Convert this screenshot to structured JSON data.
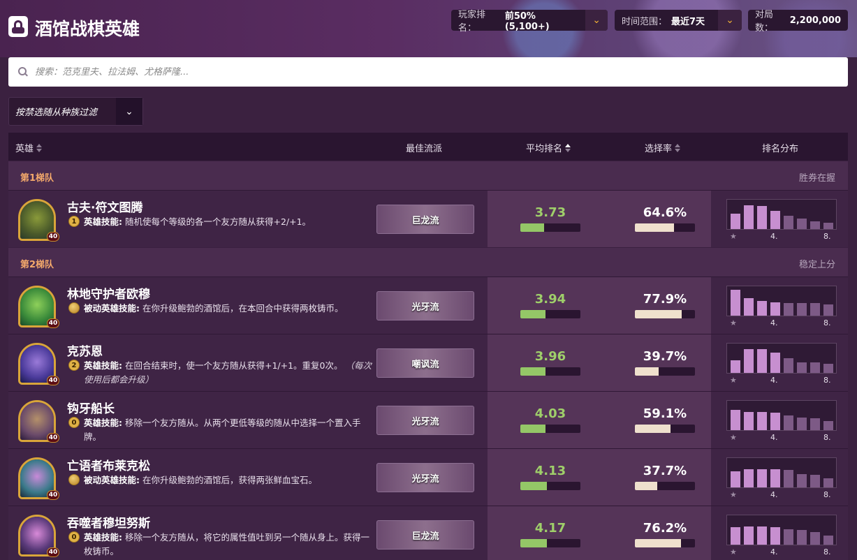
{
  "header": {
    "title": "酒馆战棋英雄",
    "filters": [
      {
        "label": "玩家排名：",
        "value": "前50% (5,100+)"
      },
      {
        "label": "时间范围：",
        "value": "最近7天"
      }
    ],
    "games_label": "对局数：",
    "games_value": "2,200,000"
  },
  "search": {
    "placeholder": "搜索：范克里夫、拉法姆、尤格萨隆..."
  },
  "filter_dropdown": {
    "label": "按禁选随从种族过滤"
  },
  "columns": {
    "hero": "英雄",
    "comp": "最佳流派",
    "avg": "平均排名",
    "pick": "选择率",
    "dist": "排名分布"
  },
  "colors": {
    "accent": "#f2b134",
    "avg_green": "#9fcf6a",
    "tier_orange": "#f4a96b",
    "bar_dark": "#c78fd0",
    "bar_light": "#7d5a86"
  },
  "dist_labels": {
    "mid": "4.",
    "end": "8."
  },
  "tiers": [
    {
      "name": "第1梯队",
      "desc": "胜券在握",
      "heroes": [
        {
          "name": "古夫·符文图腾",
          "level": "40",
          "power_cost": "1",
          "power_passive": false,
          "power_type": "英雄技能:",
          "power_text": " 随机使每个等级的各一个友方随从获得+2/+1。",
          "power_note": "",
          "comp": "巨龙流",
          "avg": "3.73",
          "avg_fraction": 0.39,
          "pick": "64.6%",
          "pick_fraction": 0.646,
          "dist": [
            0.5,
            0.78,
            0.74,
            0.6,
            0.44,
            0.33,
            0.25,
            0.2
          ],
          "portrait": "portrait-guff"
        }
      ]
    },
    {
      "name": "第2梯队",
      "desc": "稳定上分",
      "heroes": [
        {
          "name": "林地守护者欧穆",
          "level": "40",
          "power_cost": "",
          "power_passive": true,
          "power_type": "被动英雄技能:",
          "power_text": " 在你升级鲍勃的酒馆后，在本回合中获得两枚铸币。",
          "power_note": "",
          "comp": "光牙流",
          "avg": "3.94",
          "avg_fraction": 0.42,
          "pick": "77.9%",
          "pick_fraction": 0.779,
          "dist": [
            0.85,
            0.56,
            0.47,
            0.44,
            0.42,
            0.42,
            0.42,
            0.37
          ],
          "portrait": "portrait-omu"
        },
        {
          "name": "克苏恩",
          "level": "40",
          "power_cost": "2",
          "power_passive": false,
          "power_type": "英雄技能:",
          "power_text": " 在回合结束时，使一个友方随从获得+1/+1。重复0次。",
          "power_note": " （每次使用后都会升级）",
          "comp": "嘲讽流",
          "avg": "3.96",
          "avg_fraction": 0.42,
          "pick": "39.7%",
          "pick_fraction": 0.397,
          "dist": [
            0.42,
            0.77,
            0.77,
            0.65,
            0.47,
            0.35,
            0.33,
            0.3
          ],
          "portrait": "portrait-cthun"
        },
        {
          "name": "钩牙船长",
          "level": "40",
          "power_cost": "0",
          "power_passive": false,
          "power_type": "英雄技能:",
          "power_text": " 移除一个友方随从。从两个更低等级的随从中选择一个置入手牌。",
          "power_note": "",
          "comp": "光牙流",
          "avg": "4.03",
          "avg_fraction": 0.42,
          "pick": "59.1%",
          "pick_fraction": 0.591,
          "dist": [
            0.65,
            0.6,
            0.58,
            0.56,
            0.48,
            0.42,
            0.38,
            0.3
          ],
          "portrait": "portrait-hooktusk"
        },
        {
          "name": "亡语者布莱克松",
          "level": "40",
          "power_cost": "",
          "power_passive": true,
          "power_type": "被动英雄技能:",
          "power_text": " 在你升级鲍勃的酒馆后，获得两张鲜血宝石。",
          "power_note": "",
          "comp": "光牙流",
          "avg": "4.13",
          "avg_fraction": 0.44,
          "pick": "37.7%",
          "pick_fraction": 0.377,
          "dist": [
            0.53,
            0.58,
            0.6,
            0.6,
            0.56,
            0.44,
            0.4,
            0.3
          ],
          "portrait": "portrait-blackthorn"
        },
        {
          "name": "吞噬者穆坦努斯",
          "level": "40",
          "power_cost": "0",
          "power_passive": false,
          "power_type": "英雄技能:",
          "power_text": " 移除一个友方随从，将它的属性值吐到另一个随从身上。获得一枚铸币。",
          "power_note": "",
          "comp": "巨龙流",
          "avg": "4.17",
          "avg_fraction": 0.44,
          "pick": "76.2%",
          "pick_fraction": 0.762,
          "dist": [
            0.56,
            0.6,
            0.6,
            0.56,
            0.5,
            0.47,
            0.42,
            0.3
          ],
          "portrait": "portrait-mutanus"
        }
      ]
    }
  ]
}
